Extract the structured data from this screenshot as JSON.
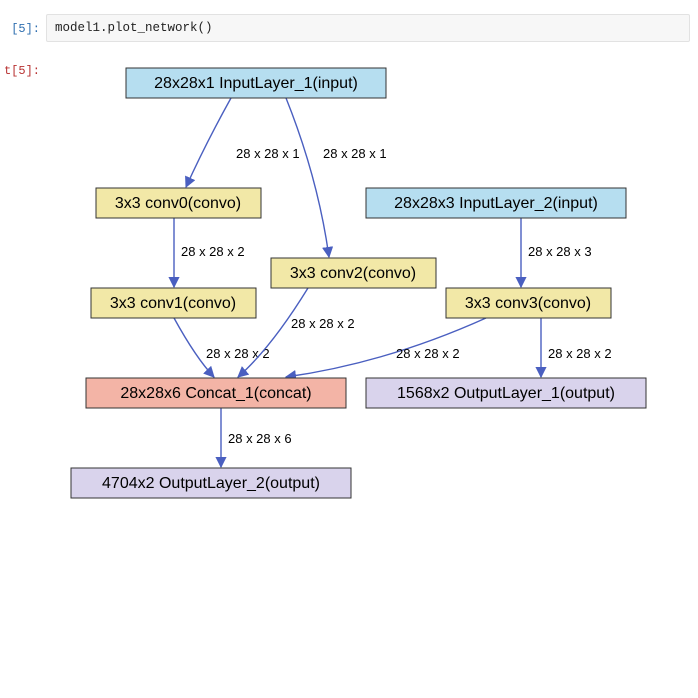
{
  "cell": {
    "in_prompt": "[5]:",
    "out_prompt": "t[5]:",
    "code": "model1.plot_network()"
  },
  "graph": {
    "nodes": {
      "input1": {
        "label": "28x28x1 InputLayer_1(input)",
        "color": "#b6def0"
      },
      "input2": {
        "label": "28x28x3 InputLayer_2(input)",
        "color": "#b6def0"
      },
      "conv0": {
        "label": "3x3 conv0(convo)",
        "color": "#f2e8a7"
      },
      "conv1": {
        "label": "3x3 conv1(convo)",
        "color": "#f2e8a7"
      },
      "conv2": {
        "label": "3x3 conv2(convo)",
        "color": "#f2e8a7"
      },
      "conv3": {
        "label": "3x3 conv3(convo)",
        "color": "#f2e8a7"
      },
      "concat": {
        "label": "28x28x6 Concat_1(concat)",
        "color": "#f3b4a6"
      },
      "out1": {
        "label": "1568x2 OutputLayer_1(output)",
        "color": "#d9d3ec"
      },
      "out2": {
        "label": "4704x2 OutputLayer_2(output)",
        "color": "#d9d3ec"
      }
    },
    "edges": {
      "e1": {
        "label": "28 x 28 x 1"
      },
      "e2": {
        "label": "28 x 28 x 1"
      },
      "e3": {
        "label": "28 x 28 x 2"
      },
      "e4": {
        "label": "28 x 28 x 3"
      },
      "e5": {
        "label": "28 x 28 x 2"
      },
      "e6": {
        "label": "28 x 28 x 2"
      },
      "e7": {
        "label": "28 x 28 x 2"
      },
      "e8": {
        "label": "28 x 28 x 2"
      },
      "e9": {
        "label": "28 x 28 x 6"
      }
    }
  }
}
